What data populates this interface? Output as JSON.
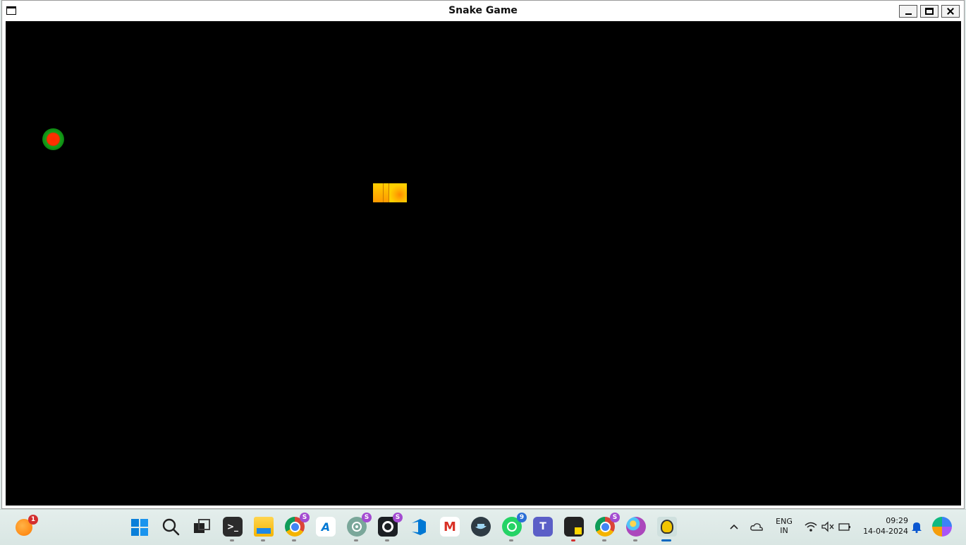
{
  "window": {
    "title": "Snake Game"
  },
  "game": {
    "background": "#000000",
    "food_color": "#ff2a00",
    "food_ring_color": "#17a31b",
    "snake_color": "#ffc400",
    "snake_segments": 3
  },
  "taskbar": {
    "weather_badge": "1",
    "icons": [
      {
        "name": "start-icon"
      },
      {
        "name": "search-icon"
      },
      {
        "name": "task-view-icon"
      },
      {
        "name": "terminal-icon"
      },
      {
        "name": "file-explorer-icon"
      },
      {
        "name": "chrome-icon",
        "badge": "S"
      },
      {
        "name": "azure-icon",
        "label": "A"
      },
      {
        "name": "chatgpt-icon",
        "badge": "S"
      },
      {
        "name": "github-icon",
        "badge": "S"
      },
      {
        "name": "azure-devops-icon"
      },
      {
        "name": "gmail-icon",
        "label": "M"
      },
      {
        "name": "docker-icon"
      },
      {
        "name": "whatsapp-icon",
        "badge": "9"
      },
      {
        "name": "teams-icon"
      },
      {
        "name": "sticky-notes-icon"
      },
      {
        "name": "chrome-profile-icon",
        "badge": "S"
      },
      {
        "name": "paint-icon"
      },
      {
        "name": "python-game-icon"
      }
    ]
  },
  "tray": {
    "language_top": "ENG",
    "language_bottom": "IN",
    "time": "09:29",
    "date": "14-04-2024"
  }
}
